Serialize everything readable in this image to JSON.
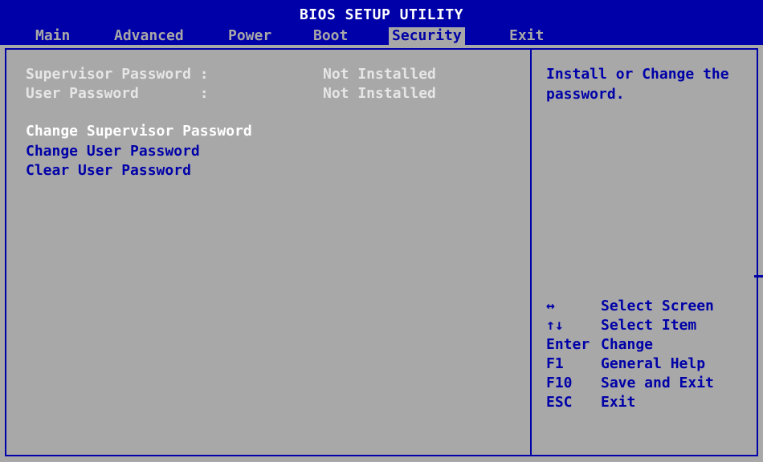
{
  "title": "BIOS SETUP UTILITY",
  "tabs": [
    {
      "label": "Main"
    },
    {
      "label": "Advanced"
    },
    {
      "label": "Power"
    },
    {
      "label": "Boot"
    },
    {
      "label": "Security"
    },
    {
      "label": "Exit"
    }
  ],
  "active_tab": "Security",
  "status": [
    {
      "label": "Supervisor Password :",
      "value": "Not Installed"
    },
    {
      "label": "User Password       :",
      "value": "Not Installed"
    }
  ],
  "actions": [
    {
      "label": "Change Supervisor Password"
    },
    {
      "label": "Change User Password"
    },
    {
      "label": "Clear User Password"
    }
  ],
  "help": {
    "line1": "Install or Change the",
    "line2": "password."
  },
  "keys": [
    {
      "key": "↔",
      "desc": "Select Screen"
    },
    {
      "key": "↑↓",
      "desc": "Select Item"
    },
    {
      "key": "Enter",
      "desc": "Change"
    },
    {
      "key": "F1",
      "desc": "General Help"
    },
    {
      "key": "F10",
      "desc": "Save and Exit"
    },
    {
      "key": "ESC",
      "desc": "Exit"
    }
  ],
  "colors": {
    "background": "#a8a8a8",
    "accent": "#0000a8",
    "highlight": "#ffffff"
  }
}
